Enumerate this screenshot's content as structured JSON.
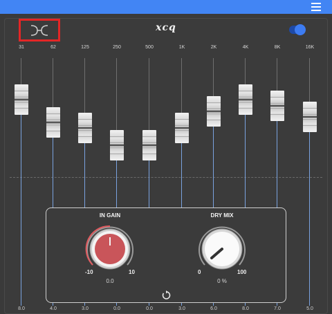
{
  "header": {
    "menu_icon": "hamburger-menu-icon",
    "color": "#4285f4"
  },
  "logo": {
    "icon": "xeq-logo-icon",
    "border_color": "#e32626"
  },
  "app_title": "xcq",
  "power_toggle": {
    "on": true,
    "color": "#3d7cf2"
  },
  "bands": [
    {
      "freq": "31",
      "value": "8.0"
    },
    {
      "freq": "62",
      "value": "4.0"
    },
    {
      "freq": "125",
      "value": "3.0"
    },
    {
      "freq": "250",
      "value": "0.0"
    },
    {
      "freq": "500",
      "value": "0.0"
    },
    {
      "freq": "1K",
      "value": "3.0"
    },
    {
      "freq": "2K",
      "value": "6.0"
    },
    {
      "freq": "4K",
      "value": "8.0"
    },
    {
      "freq": "8K",
      "value": "7.0"
    },
    {
      "freq": "16K",
      "value": "5.0"
    }
  ],
  "in_gain": {
    "title": "IN GAIN",
    "min": "-10",
    "max": "10",
    "value": "0.0",
    "level": 0.5,
    "color": "#c9555a"
  },
  "dry_mix": {
    "title": "DRY MIX",
    "min": "0",
    "max": "100",
    "value": "0 %",
    "level": 0.0
  },
  "reset_icon": "reset-icon"
}
